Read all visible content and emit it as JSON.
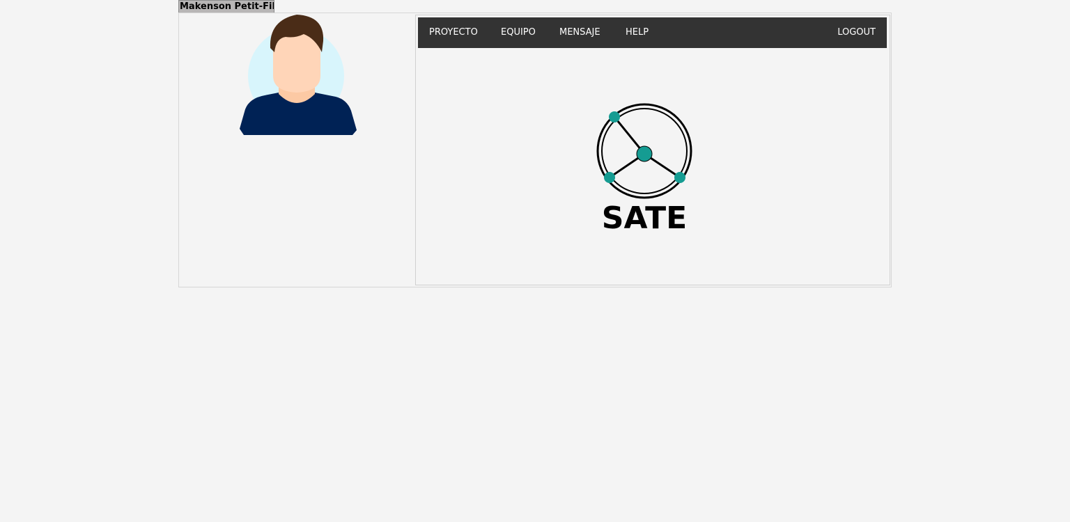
{
  "user": {
    "name": "Makenson Petit-Fils"
  },
  "nav": {
    "items": [
      {
        "label": "PROYECTO"
      },
      {
        "label": "EQUIPO"
      },
      {
        "label": "MENSAJE"
      },
      {
        "label": "HELP"
      }
    ],
    "logout_label": "LOGOUT"
  },
  "logo": {
    "text": "SATE"
  },
  "colors": {
    "page_background": "#f4f4f4",
    "navbar_background": "#333333",
    "navbar_text": "#ffffff",
    "logo_accent": "#159c92",
    "avatar_shirt": "#002255",
    "avatar_hair": "#4a2c17",
    "avatar_skin": "#ffd5b8",
    "avatar_halo": "#d8f5fc"
  },
  "icons": {
    "avatar": "user-avatar-icon",
    "logo": "sate-network-logo"
  }
}
